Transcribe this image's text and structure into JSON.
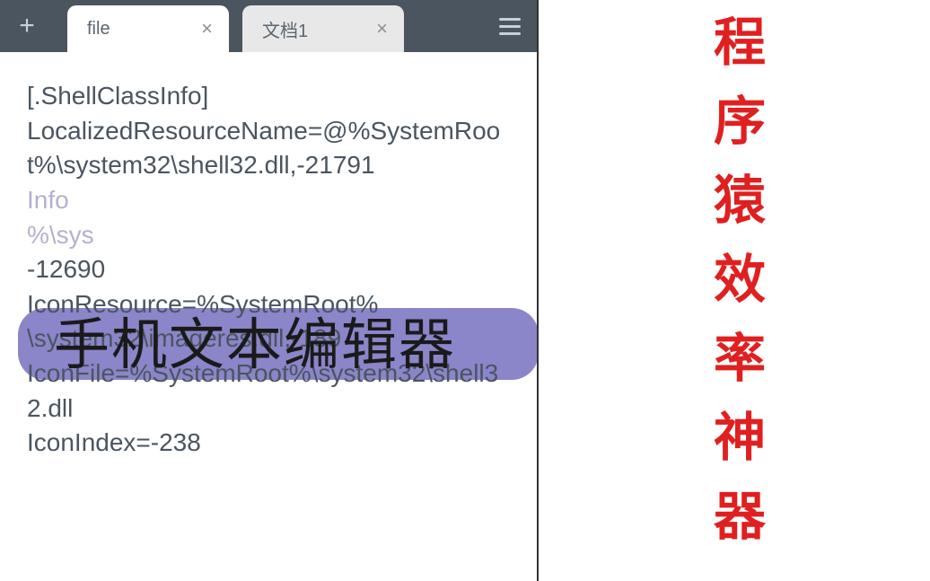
{
  "toolbar": {
    "add_label": "+",
    "menu_label": "☰"
  },
  "tabs": [
    {
      "label": "file",
      "close": "×",
      "active": true
    },
    {
      "label": "文档1",
      "close": "×",
      "active": false
    }
  ],
  "editor": {
    "line1": "[.ShellClassInfo]",
    "line2": "LocalizedResourceName=@%SystemRoot%\\system32\\shell32.dll,-21791",
    "line3_obscured_a": "Info",
    "line3_obscured_b": "%\\sys",
    "line4": "-12690",
    "line5": "IconResource=%SystemRoot%",
    "line6": "\\system32\\imageres.dll,-189",
    "line7": "IconFile=%SystemRoot%\\system32\\shell32.dll",
    "line8": "IconIndex=-238"
  },
  "overlay": {
    "title": "手机文本编辑器"
  },
  "sidebar": {
    "vertical_text": "程序猿效率神器"
  }
}
